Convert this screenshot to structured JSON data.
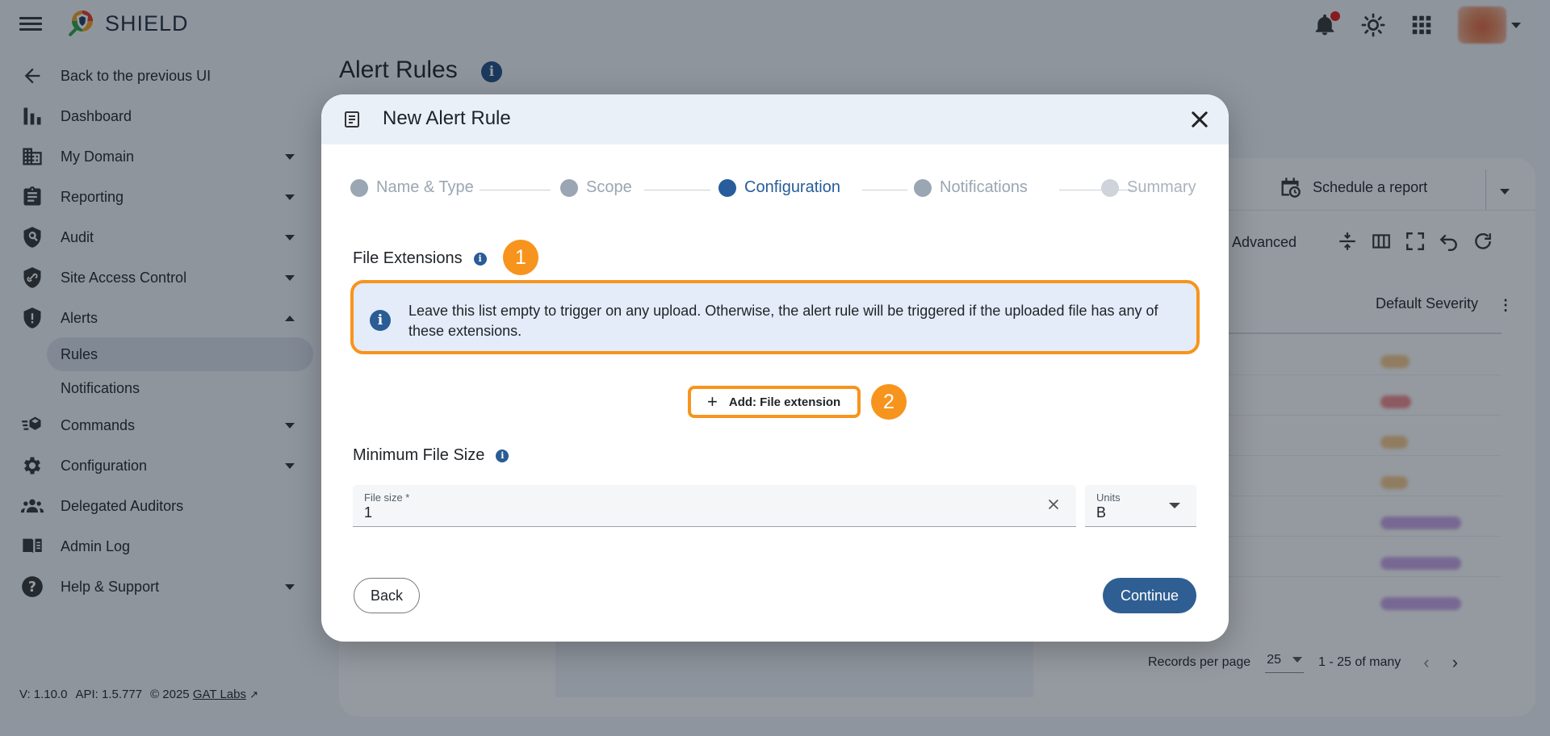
{
  "app": {
    "brand": "SHIELD"
  },
  "sidebar": {
    "back": "Back to the previous UI",
    "items": [
      {
        "label": "Dashboard"
      },
      {
        "label": "My Domain"
      },
      {
        "label": "Reporting"
      },
      {
        "label": "Audit"
      },
      {
        "label": "Site Access Control"
      },
      {
        "label": "Alerts"
      },
      {
        "label": "Commands"
      },
      {
        "label": "Configuration"
      },
      {
        "label": "Delegated Auditors"
      },
      {
        "label": "Admin Log"
      },
      {
        "label": "Help & Support"
      }
    ],
    "alerts_sub": [
      {
        "label": "Rules"
      },
      {
        "label": "Notifications"
      }
    ]
  },
  "footer": {
    "version": "V: 1.10.0",
    "api": "API: 1.5.777",
    "copyright": "© 2025",
    "link": "GAT Labs"
  },
  "page": {
    "title": "Alert Rules",
    "schedule_label": "Schedule a report",
    "advanced_label": "Advanced",
    "severity_header": "Default Severity",
    "records_label": "Records per page",
    "records_value": "25",
    "range_label": "1 - 25 of many"
  },
  "modal": {
    "title": "New Alert Rule",
    "steps": [
      {
        "label": "Name & Type"
      },
      {
        "label": "Scope"
      },
      {
        "label": "Configuration"
      },
      {
        "label": "Notifications"
      },
      {
        "label": "Summary"
      }
    ],
    "file_ext_title": "File Extensions",
    "callout_1": "1",
    "info_text": "Leave this list empty to trigger on any upload. Otherwise, the alert rule will be triggered if the uploaded file has any of these extensions.",
    "add_label": "Add: File extension",
    "callout_2": "2",
    "min_size_title": "Minimum File Size",
    "file_size_label": "File size *",
    "file_size_value": "1",
    "units_label": "Units",
    "units_value": "B",
    "back_label": "Back",
    "continue_label": "Continue"
  },
  "colors": {
    "accent": "#2f5f92",
    "callout": "#f7941d",
    "info_bg": "#e3ecf8"
  }
}
